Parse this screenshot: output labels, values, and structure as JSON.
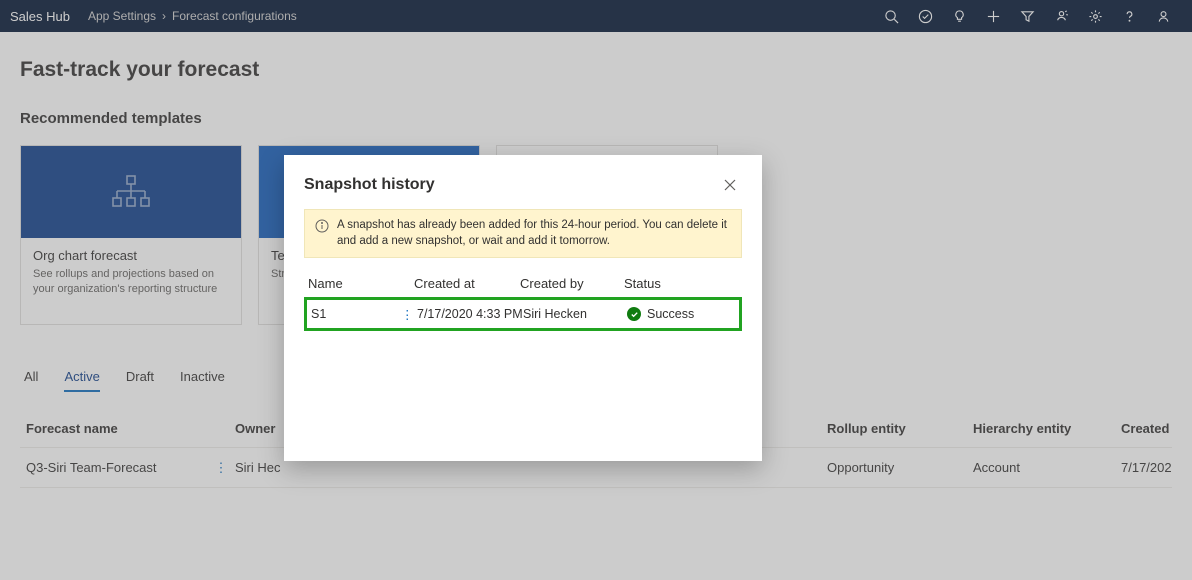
{
  "topbar": {
    "app_name": "Sales Hub",
    "breadcrumb": [
      "App Settings",
      "Forecast configurations"
    ]
  },
  "page": {
    "title": "Fast-track your forecast",
    "recommended_label": "Recommended templates"
  },
  "cards": [
    {
      "name": "Org chart forecast",
      "desc": "See rollups and projections based on your organization's reporting structure"
    },
    {
      "name": "Te",
      "desc": "Str\npro"
    },
    {
      "name": "",
      "desc": ""
    }
  ],
  "tabs": [
    "All",
    "Active",
    "Draft",
    "Inactive"
  ],
  "active_tab_index": 1,
  "grid": {
    "headers": {
      "name": "Forecast name",
      "owner": "Owner",
      "rollup": "Rollup entity",
      "hierarchy": "Hierarchy entity",
      "created": "Created"
    },
    "rows": [
      {
        "name": "Q3-Siri Team-Forecast",
        "owner": "Siri Hec",
        "rollup": "Opportunity",
        "hierarchy": "Account",
        "created": "7/17/202"
      }
    ]
  },
  "modal": {
    "title": "Snapshot history",
    "info": "A snapshot has already been added for this 24-hour period. You can delete it and add a new snapshot, or wait and add it tomorrow.",
    "headers": {
      "name": "Name",
      "created": "Created at",
      "by": "Created by",
      "status": "Status"
    },
    "rows": [
      {
        "name": "S1",
        "created": "7/17/2020 4:33 PM",
        "by": "Siri Hecken",
        "status": "Success"
      }
    ]
  }
}
